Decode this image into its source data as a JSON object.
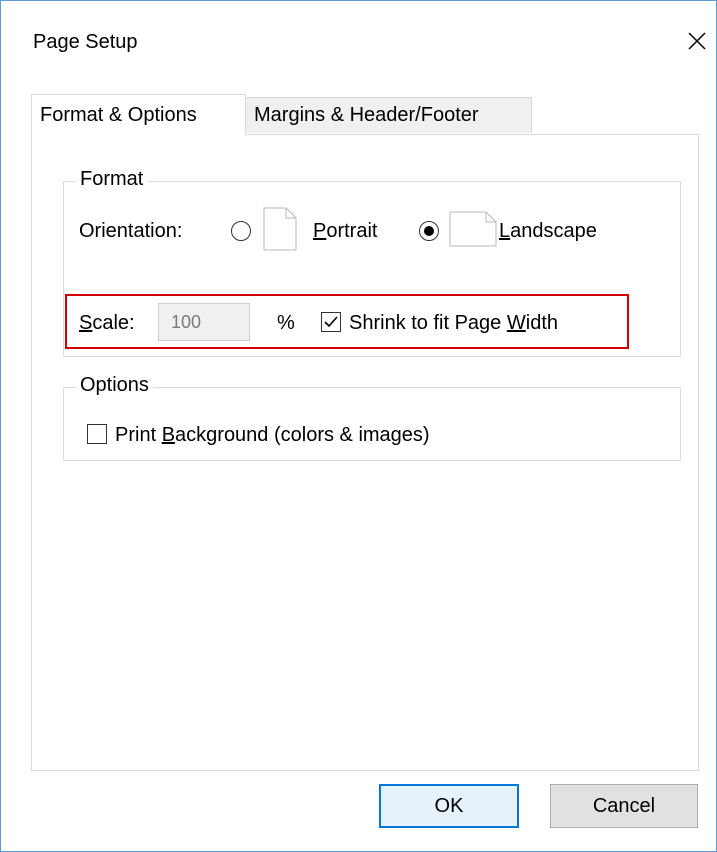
{
  "window": {
    "title": "Page Setup"
  },
  "tabs": [
    {
      "label": "Format & Options",
      "active": true
    },
    {
      "label": "Margins & Header/Footer",
      "active": false
    }
  ],
  "format_group": {
    "legend": "Format",
    "orientation_label": "Orientation:",
    "portrait": {
      "pre": "",
      "mnemonic": "P",
      "post": "ortrait",
      "selected": false
    },
    "landscape": {
      "pre": "",
      "mnemonic": "L",
      "post": "andscape",
      "selected": true
    },
    "scale_label": {
      "mnemonic": "S",
      "post": "cale:"
    },
    "scale_value": "100",
    "percent": "%",
    "shrink": {
      "pre": "Shrink to fit Page ",
      "mnemonic": "W",
      "post": "idth",
      "checked": true
    }
  },
  "options_group": {
    "legend": "Options",
    "print_background": {
      "pre": "Print ",
      "mnemonic": "B",
      "post": "ackground (colors & images)",
      "checked": false
    }
  },
  "buttons": {
    "ok": "OK",
    "cancel": "Cancel"
  },
  "colors": {
    "highlight": "#d20000",
    "focus_border": "#0078d7",
    "window_border": "#5a9bd5"
  },
  "icons": {
    "close": "close-icon",
    "portrait_page": "portrait-page-icon",
    "landscape_page": "landscape-page-icon",
    "checkmark": "checkmark-icon"
  }
}
